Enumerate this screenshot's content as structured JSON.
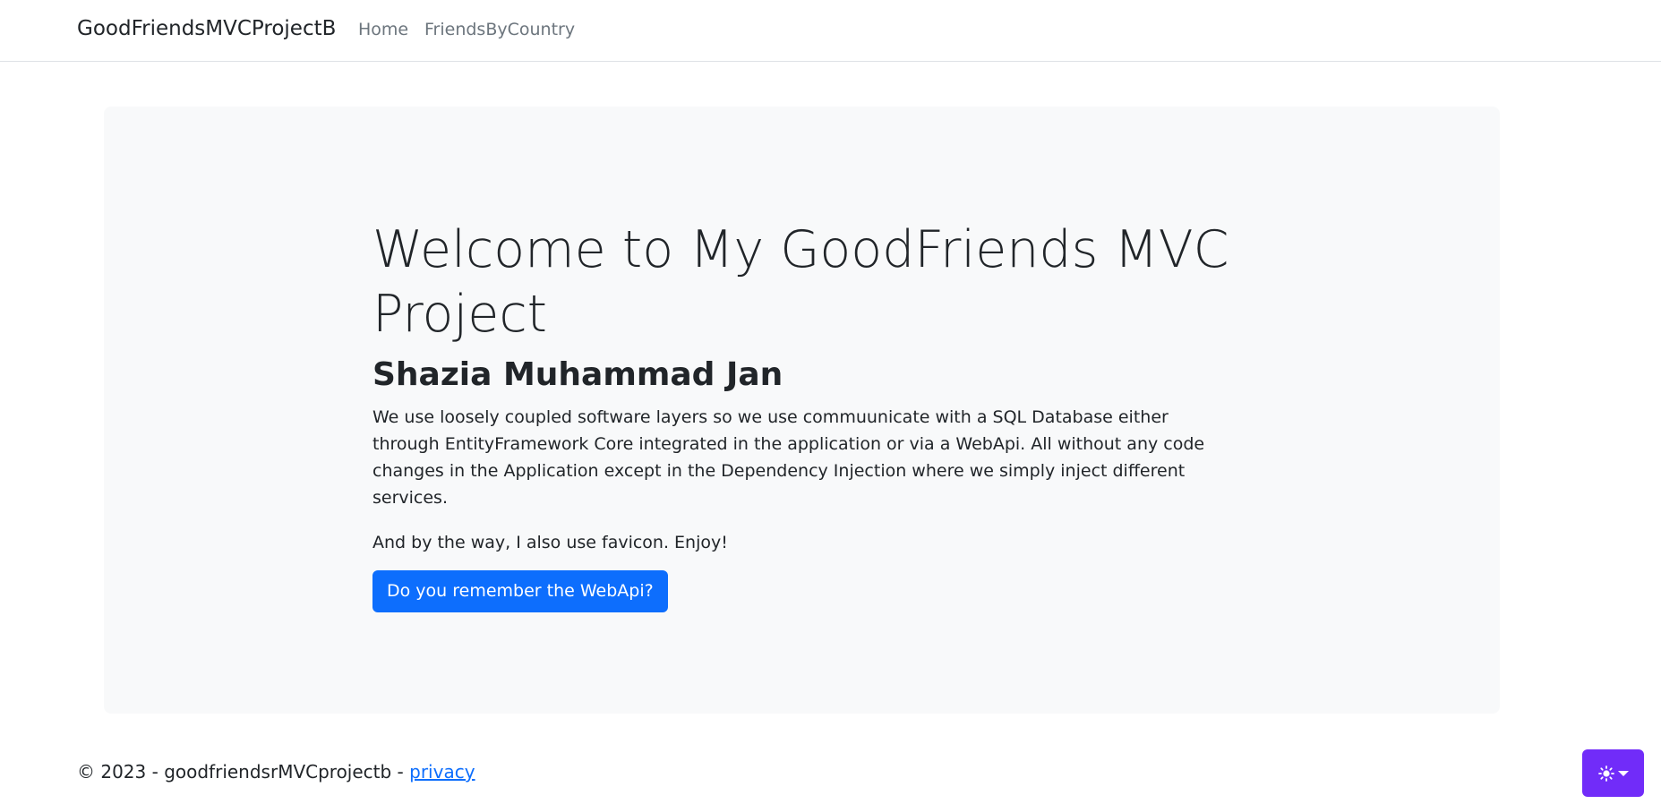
{
  "navbar": {
    "brand": "GoodFriendsMVCProjectB",
    "links": [
      {
        "label": "Home"
      },
      {
        "label": "FriendsByCountry"
      }
    ]
  },
  "hero": {
    "title": "Welcome to My GoodFriends MVC Project",
    "subtitle": "Shazia Muhammad Jan",
    "paragraph": "We use loosely coupled software layers so we use commuunicate with a SQL Database either through EntityFramework Core integrated in the application or via a WebApi. All without any code changes in the Application except in the Dependency Injection where we simply inject different services.",
    "paragraph2": "And by the way, I also use favicon. Enjoy!",
    "button_label": "Do you remember the WebApi?"
  },
  "footer": {
    "text": "© 2023 - goodfriendsrMVCprojectb - ",
    "privacy_link": "privacy"
  },
  "theme_toggle": {
    "icons": [
      "sun-icon",
      "caret-down-icon"
    ],
    "color": "#712cf9"
  },
  "colors": {
    "primary": "#0d6efd",
    "jumbotron_bg": "#f8f9fa",
    "theme_button": "#712cf9"
  }
}
